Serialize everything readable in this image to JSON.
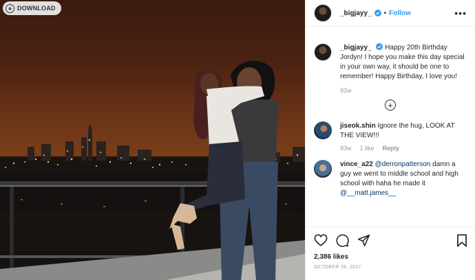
{
  "download": {
    "label": "DOWNLOAD",
    "icon": "download-icon"
  },
  "header": {
    "username": "_bigjayy_",
    "separator": "•",
    "follow_label": "Follow",
    "more_icon": "more-options-icon"
  },
  "caption": {
    "username": "_bigjayy_",
    "text": "Happy 20th Birthday Jordyn! I hope you make this day special in your own way, it should be one to remember! Happy Birthday, I love you!",
    "time": "93w"
  },
  "load_more_icon": "plus-circle-icon",
  "comments": [
    {
      "username": "jiseok.shin",
      "text": "Ignore the hug, LOOK AT THE VIEW!!!",
      "time": "93w",
      "likes": "1 like",
      "reply": "Reply"
    },
    {
      "username": "vince_a22",
      "mention1": "@derronpatterson",
      "text": "damn a guy we went to middle school and high school with haha he made it",
      "mention2": "@__matt.james__"
    }
  ],
  "actions": {
    "icons": [
      "heart-icon",
      "comment-icon",
      "share-icon",
      "bookmark-icon"
    ],
    "likes": "2,386 likes",
    "date": "OCTOBER 28, 2017"
  },
  "colors": {
    "link": "#3897f0",
    "muted": "#999999",
    "verified": "#3897f0"
  }
}
